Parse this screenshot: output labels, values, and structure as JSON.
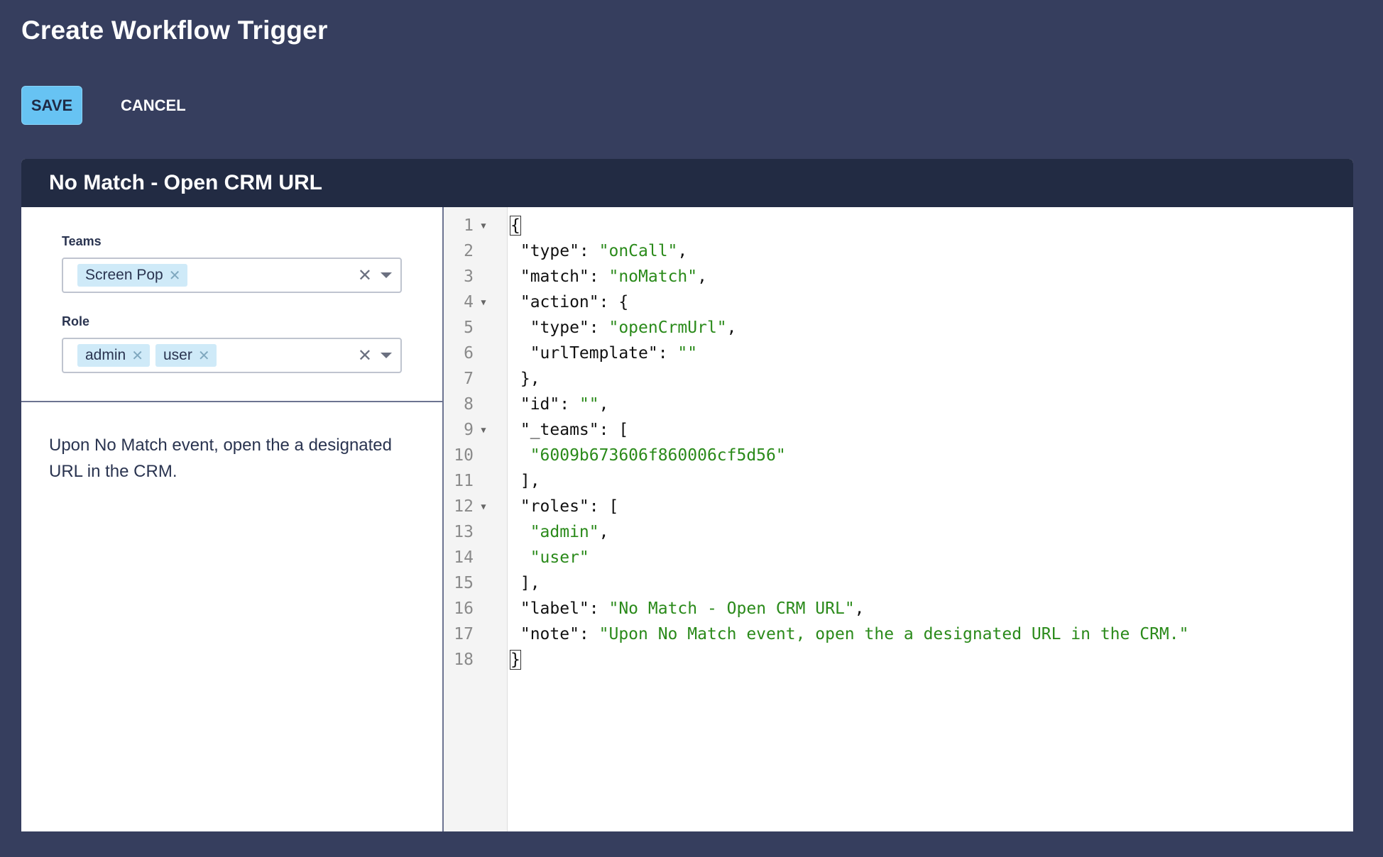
{
  "page": {
    "title": "Create Workflow Trigger"
  },
  "actions": {
    "save_label": "SAVE",
    "cancel_label": "CANCEL"
  },
  "panel": {
    "title": "No Match - Open CRM URL",
    "teams": {
      "label": "Teams",
      "chips": [
        "Screen Pop"
      ]
    },
    "role": {
      "label": "Role",
      "chips": [
        "admin",
        "user"
      ]
    },
    "note": "Upon No Match event, open the a designated URL in the CRM."
  },
  "editor": {
    "lines": [
      {
        "n": "1",
        "fold": true,
        "parts": [
          [
            "p",
            "{"
          ]
        ]
      },
      {
        "n": "2",
        "fold": false,
        "parts": [
          [
            "p",
            " \"type\": "
          ],
          [
            "s",
            "\"onCall\""
          ],
          [
            "p",
            ","
          ]
        ]
      },
      {
        "n": "3",
        "fold": false,
        "parts": [
          [
            "p",
            " \"match\": "
          ],
          [
            "s",
            "\"noMatch\""
          ],
          [
            "p",
            ","
          ]
        ]
      },
      {
        "n": "4",
        "fold": true,
        "parts": [
          [
            "p",
            " \"action\": {"
          ]
        ]
      },
      {
        "n": "5",
        "fold": false,
        "parts": [
          [
            "p",
            "  \"type\": "
          ],
          [
            "s",
            "\"openCrmUrl\""
          ],
          [
            "p",
            ","
          ]
        ]
      },
      {
        "n": "6",
        "fold": false,
        "parts": [
          [
            "p",
            "  \"urlTemplate\": "
          ],
          [
            "s",
            "\"\""
          ]
        ]
      },
      {
        "n": "7",
        "fold": false,
        "parts": [
          [
            "p",
            " },"
          ]
        ]
      },
      {
        "n": "8",
        "fold": false,
        "parts": [
          [
            "p",
            " \"id\": "
          ],
          [
            "s",
            "\"\""
          ],
          [
            "p",
            ","
          ]
        ]
      },
      {
        "n": "9",
        "fold": true,
        "parts": [
          [
            "p",
            " \"_teams\": ["
          ]
        ]
      },
      {
        "n": "10",
        "fold": false,
        "parts": [
          [
            "s",
            "  \"6009b673606f860006cf5d56\""
          ]
        ]
      },
      {
        "n": "11",
        "fold": false,
        "parts": [
          [
            "p",
            " ],"
          ]
        ]
      },
      {
        "n": "12",
        "fold": true,
        "parts": [
          [
            "p",
            " \"roles\": ["
          ]
        ]
      },
      {
        "n": "13",
        "fold": false,
        "parts": [
          [
            "s",
            "  \"admin\""
          ],
          [
            "p",
            ","
          ]
        ]
      },
      {
        "n": "14",
        "fold": false,
        "parts": [
          [
            "s",
            "  \"user\""
          ]
        ]
      },
      {
        "n": "15",
        "fold": false,
        "parts": [
          [
            "p",
            " ],"
          ]
        ]
      },
      {
        "n": "16",
        "fold": false,
        "parts": [
          [
            "p",
            " \"label\": "
          ],
          [
            "s",
            "\"No Match - Open CRM URL\""
          ],
          [
            "p",
            ","
          ]
        ]
      },
      {
        "n": "17",
        "fold": false,
        "parts": [
          [
            "p",
            " \"note\": "
          ],
          [
            "s",
            "\"Upon No Match event, open the a designated URL in the CRM.\""
          ]
        ]
      },
      {
        "n": "18",
        "fold": false,
        "parts": [
          [
            "p",
            "}"
          ]
        ]
      }
    ]
  }
}
